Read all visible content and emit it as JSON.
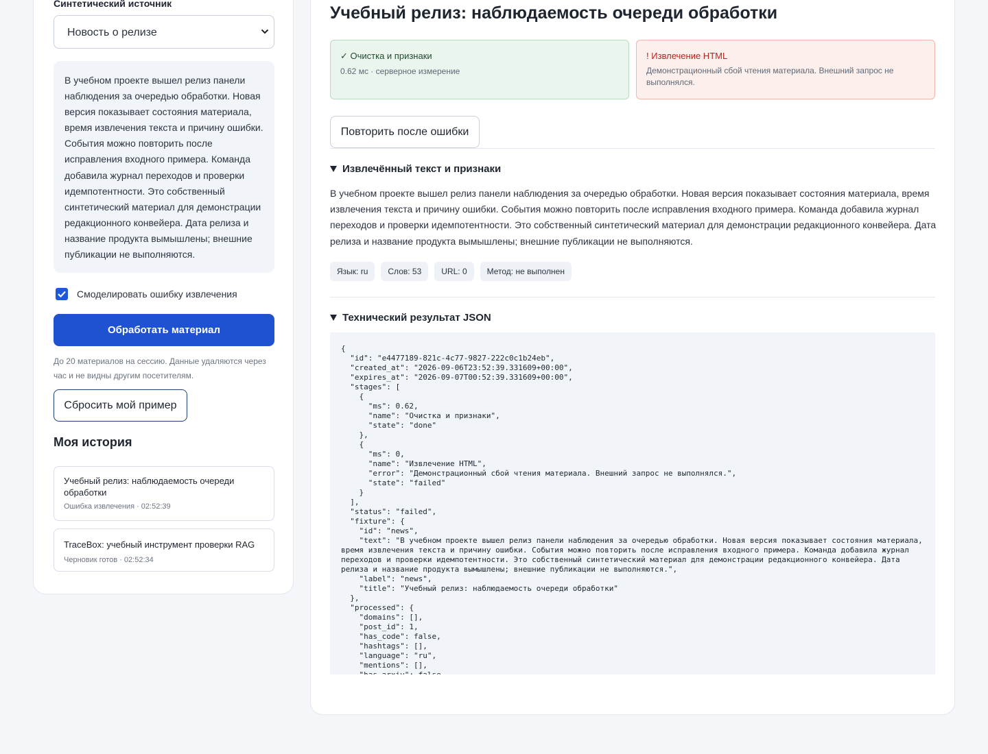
{
  "sidebar": {
    "source_label": "Синтетический источник",
    "source_select": "Новость о релизе",
    "preview_text": "В учебном проекте вышел релиз панели наблюдения за очередью обработки. Новая версия показывает состояния материала, время извлечения текста и причину ошибки. События можно повторить после исправления входного примера. Команда добавила журнал переходов и проверки идемпотентности. Это собственный синтетический материал для демонстрации редакционного конвейера. Дата релиза и название продукта вымышлены; внешние публикации не выполняются.",
    "simulate_error_label": "Смоделировать ошибку извлечения",
    "simulate_error_checked": true,
    "process_button": "Обработать материал",
    "note": "До 20 материалов на сессию. Данные удаляются через час и не видны другим посетителям.",
    "reset_button": "Сбросить мой пример",
    "history_title": "Моя история",
    "history": [
      {
        "title": "Учебный релиз: наблюдаемость очереди обработки",
        "meta": "Ошибка извлечения · 02:52:39"
      },
      {
        "title": "TraceBox: учебный инструмент проверки RAG",
        "meta": "Черновик готов · 02:52:34"
      }
    ]
  },
  "main": {
    "title": "Учебный релиз: наблюдаемость очереди обработки",
    "stages": [
      {
        "name": "✓ Очистка и признаки",
        "detail": "0.62 мс · серверное измерение",
        "state": "done"
      },
      {
        "name": "! Извлечение HTML",
        "detail": "Демонстрационный сбой чтения материала. Внешний запрос не выполнялся.",
        "state": "failed"
      }
    ],
    "retry_button": "Повторить после ошибки",
    "extracted_heading": "Извлечённый текст и признаки",
    "extracted_text": "В учебном проекте вышел релиз панели наблюдения за очередью обработки. Новая версия показывает состояния материала, время извлечения текста и причину ошибки. События можно повторить после исправления входного примера. Команда добавила журнал переходов и проверки идемпотентности. Это собственный синтетический материал для демонстрации редакционного конвейера. Дата релиза и название продукта вымышлены; внешние публикации не выполняются.",
    "chips": [
      "Язык: ru",
      "Слов: 53",
      "URL: 0",
      "Метод: не выполнен"
    ],
    "json_heading": "Технический результат JSON",
    "json_text": "{\n  \"id\": \"e4477189-821c-4c77-9827-222c0c1b24eb\",\n  \"created_at\": \"2026-09-06T23:52:39.331609+00:00\",\n  \"expires_at\": \"2026-09-07T00:52:39.331609+00:00\",\n  \"stages\": [\n    {\n      \"ms\": 0.62,\n      \"name\": \"Очистка и признаки\",\n      \"state\": \"done\"\n    },\n    {\n      \"ms\": 0,\n      \"name\": \"Извлечение HTML\",\n      \"error\": \"Демонстрационный сбой чтения материала. Внешний запрос не выполнялся.\",\n      \"state\": \"failed\"\n    }\n  ],\n  \"status\": \"failed\",\n  \"fixture\": {\n    \"id\": \"news\",\n    \"text\": \"В учебном проекте вышел релиз панели наблюдения за очередью обработки. Новая версия показывает состояния материала,\nвремя извлечения текста и причину ошибки. События можно повторить после исправления входного примера. Команда добавила журнал\nпереходов и проверки идемпотентности. Это собственный синтетический материал для демонстрации редакционного конвейера. Дата\nрелиза и название продукта вымышлены; внешние публикации не выполняются.\",\n    \"label\": \"news\",\n    \"title\": \"Учебный релиз: наблюдаемость очереди обработки\"\n  },\n  \"processed\": {\n    \"domains\": [],\n    \"post_id\": 1,\n    \"has_code\": false,\n    \"hashtags\": [],\n    \"language\": \"ru\",\n    \"mentions\": [],\n    \"has_arxiv\": false"
  }
}
